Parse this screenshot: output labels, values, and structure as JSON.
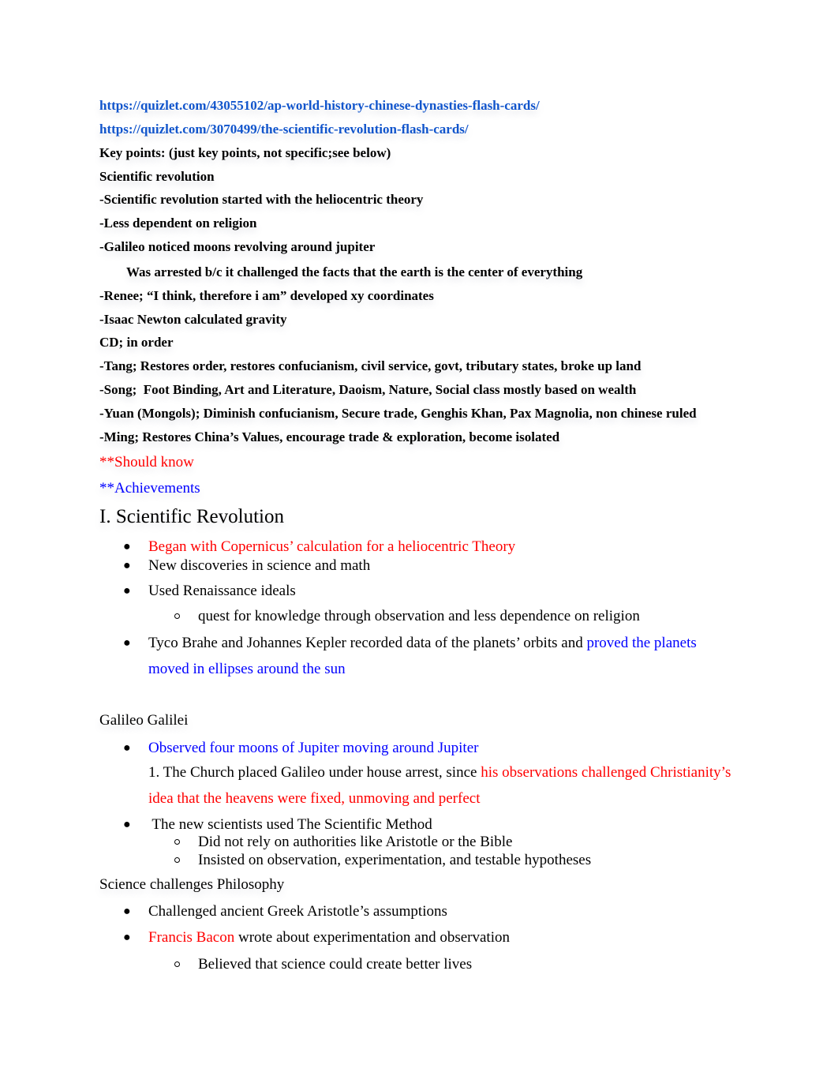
{
  "links": [
    "https://quizlet.com/43055102/ap-world-history-chinese-dynasties-flash-cards/",
    "https://quizlet.com/3070499/the-scientific-revolution-flash-cards/"
  ],
  "key_points": {
    "title": "Key points: (just key points, not specific;see below)",
    "sr_title": "Scientific revolution",
    "sr_items": [
      "-Scientific revolution started with the heliocentric theory",
      "-Less dependent on religion",
      "-Galileo noticed moons revolving around jupiter",
      "Was arrested b/c it challenged the facts that the earth is the center of everything",
      "-Renee; “I think, therefore i am” developed xy coordinates",
      "-Isaac Newton calculated gravity"
    ],
    "cd_title": "CD; in order",
    "cd_items": [
      "-Tang; Restores order, restores confucianism, civil service, govt, tributary states, broke up land",
      "-Song;  Foot Binding, Art and Literature, Daoism, Nature, Social class mostly based on wealth",
      "-Yuan (Mongols); Diminish confucianism, Secure trade, Genghis Khan, Pax Magnolia, non chinese ruled",
      "-Ming; Restores China’s Values, encourage trade & exploration, become isolated"
    ]
  },
  "legend": {
    "should_know": "**Should know",
    "achievements": "**Achievements"
  },
  "colors": {
    "link": "#1155cc",
    "should_know": "#ff0000",
    "achievement": "#0000ff"
  },
  "section1": {
    "heading": "I. Scientific Revolution",
    "b1": "Began with Copernicus’ calculation for a heliocentric Theory",
    "b2": "New discoveries in science and math",
    "b3": "Used Renaissance ideals",
    "b3_sub": "quest for knowledge through observation and less dependence on religion",
    "b4_a": "Tyco Brahe and Johannes Kepler recorded data of the planets’ orbits and ",
    "b4_b": "proved the planets",
    "b4_c": "moved in ellipses around the sun"
  },
  "galileo": {
    "title": "Galileo Galilei",
    "b1": "Observed four moons of Jupiter moving around Jupiter",
    "p1_a": "1. The Church placed Galileo under house arrest, since ",
    "p1_b": "his observations challenged Christianity’s",
    "p1_c": "idea that the heavens were fixed, unmoving and perfect",
    "b2": " The new scientists used The Scientific Method",
    "b2_sub": [
      "Did not rely on authorities like Aristotle or the Bible",
      "Insisted on observation, experimentation, and testable hypotheses"
    ]
  },
  "philosophy": {
    "title": "Science challenges Philosophy",
    "b1": "Challenged ancient Greek Aristotle’s assumptions",
    "b2_a": "Francis Bacon",
    "b2_b": " wrote about experimentation and observation",
    "b2_sub": "Believed that science could create better lives"
  }
}
